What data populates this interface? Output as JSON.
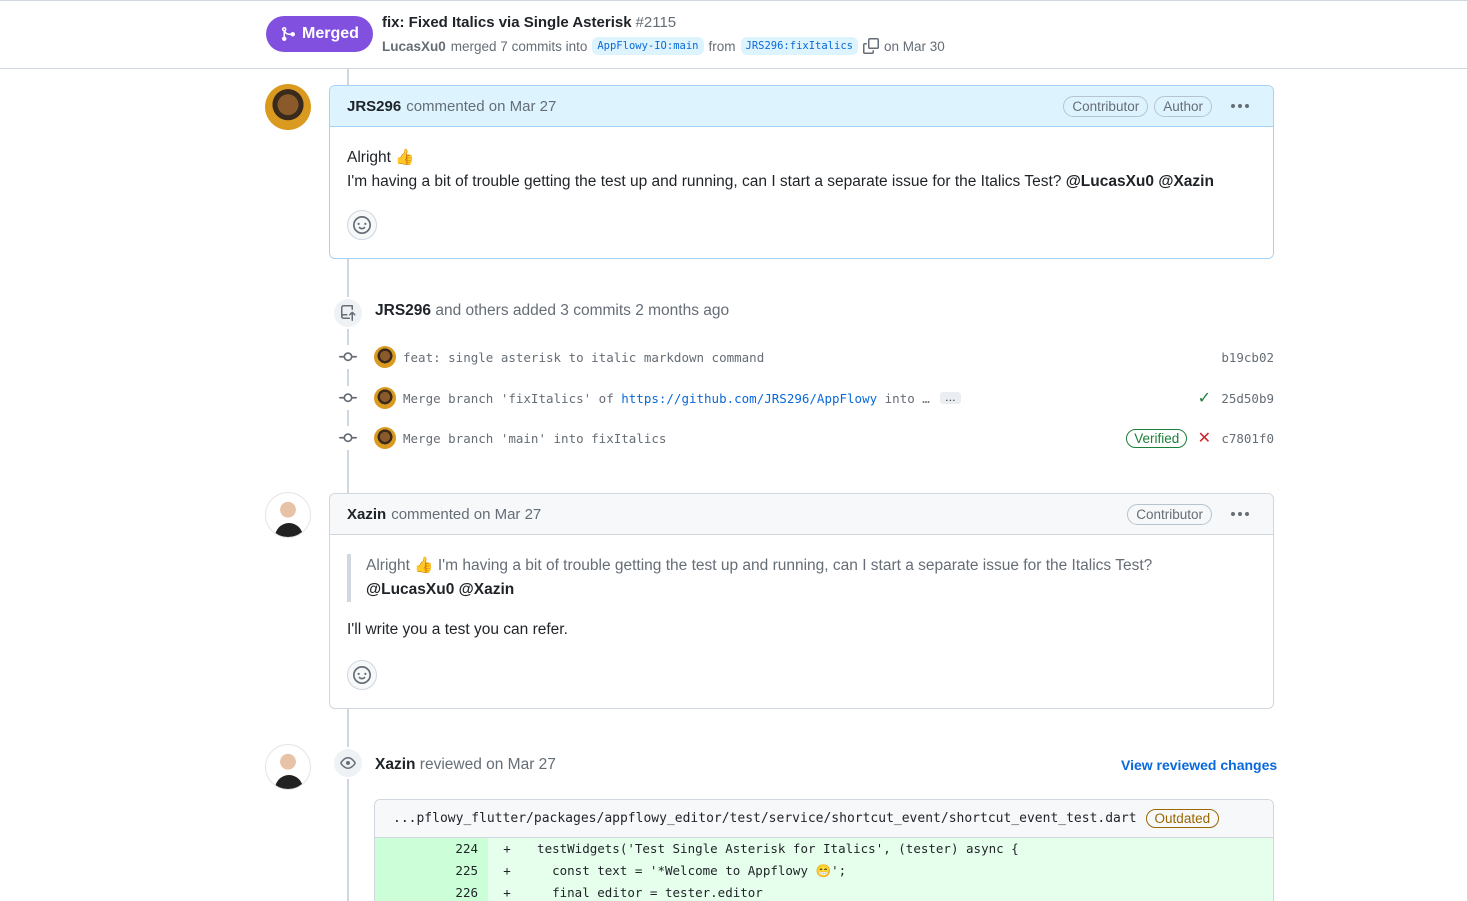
{
  "header": {
    "status": "Merged",
    "title": "fix: Fixed Italics via Single Asterisk",
    "number": "#2115",
    "merger": "LucasXu0",
    "merged_text": "merged 7 commits into",
    "base_branch": "AppFlowy-IO:main",
    "from_text": "from",
    "head_branch": "JRS296:fixItalics",
    "date_text": "on Mar 30"
  },
  "comment1": {
    "author": "JRS296",
    "action": "commented on Mar 27",
    "badges": [
      "Contributor",
      "Author"
    ],
    "line1": "Alright",
    "emoji": "👍",
    "line2": "I'm having a bit of trouble getting the test up and running, can I start a separate issue for the Italics Test?",
    "mentions": "@LucasXu0 @Xazin"
  },
  "commits": {
    "author": "JRS296",
    "summary": "and others added 3 commits 2 months ago",
    "items": [
      {
        "message": "feat: single asterisk to italic markdown command",
        "sha": "b19cb02",
        "verified": "",
        "status": ""
      },
      {
        "message_pre": "Merge branch 'fixItalics' of ",
        "link": "https://github.com/JRS296/AppFlowy",
        "message_post": " into …",
        "more": "…",
        "sha": "25d50b9",
        "status": "success"
      },
      {
        "message": "Merge branch 'main' into fixItalics",
        "sha": "c7801f0",
        "verified": "Verified",
        "status": "failure"
      }
    ]
  },
  "comment2": {
    "author": "Xazin",
    "action": "commented on Mar 27",
    "badges": [
      "Contributor"
    ],
    "quote_start": "Alright",
    "quote_emoji": "👍",
    "quote_rest": "I'm having a bit of trouble getting the test up and running, can I start a separate issue for the Italics Test?",
    "quote_mentions": "@LucasXu0 @Xazin",
    "reply": "I'll write you a test you can refer."
  },
  "review": {
    "author": "Xazin",
    "action": "reviewed on Mar 27",
    "view_link": "View reviewed changes",
    "file_path": "...pflowy_flutter/packages/appflowy_editor/test/service/shortcut_event/shortcut_event_test.dart",
    "outdated": "Outdated",
    "lines": [
      {
        "num": "224",
        "sign": "+",
        "code": "  testWidgets('Test Single Asterisk for Italics', (tester) async {"
      },
      {
        "num": "225",
        "sign": "+",
        "code": "    const text = '*Welcome to Appflowy 😁';"
      },
      {
        "num": "226",
        "sign": "+",
        "code": "    final editor = tester.editor"
      }
    ]
  },
  "colors": {
    "merged": "#8250df",
    "link": "#0969da",
    "added_bg": "#e6ffec",
    "added_num_bg": "#ccffd8"
  }
}
